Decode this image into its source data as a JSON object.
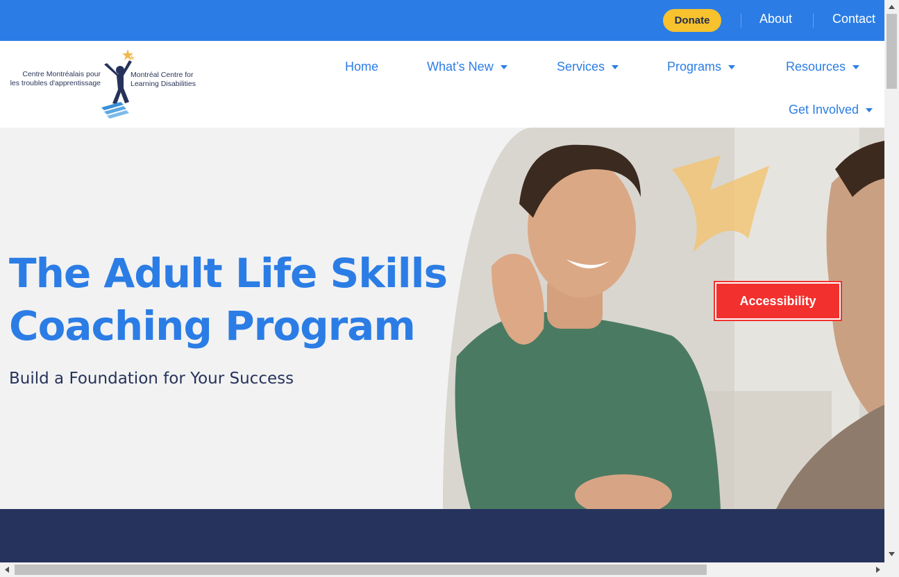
{
  "topbar": {
    "donate_label": "Donate",
    "about_label": "About",
    "contact_label": "Contact"
  },
  "logo": {
    "french_line1": "Centre Montréalais pour",
    "french_line2": "les troubles d'apprentissage",
    "english_line1": "Montréal Centre for",
    "english_line2": "Learning Disabilities"
  },
  "nav": {
    "home": "Home",
    "whats_new": "What’s New",
    "services": "Services",
    "programs": "Programs",
    "resources": "Resources",
    "get_involved": "Get Involved"
  },
  "hero": {
    "title_line1": "The Adult Life Skills",
    "title_line2": "Coaching Program",
    "subtitle": "Build a Foundation for Your Success"
  },
  "accessibility_label": "Accessibility",
  "colors": {
    "brand_blue": "#2b7de5",
    "navy": "#26335c",
    "donate_yellow": "#f7c22d",
    "accessibility_red": "#f2302d"
  },
  "icons": [
    "star-icon",
    "caret-down-icon",
    "scroll-arrow-icon"
  ]
}
